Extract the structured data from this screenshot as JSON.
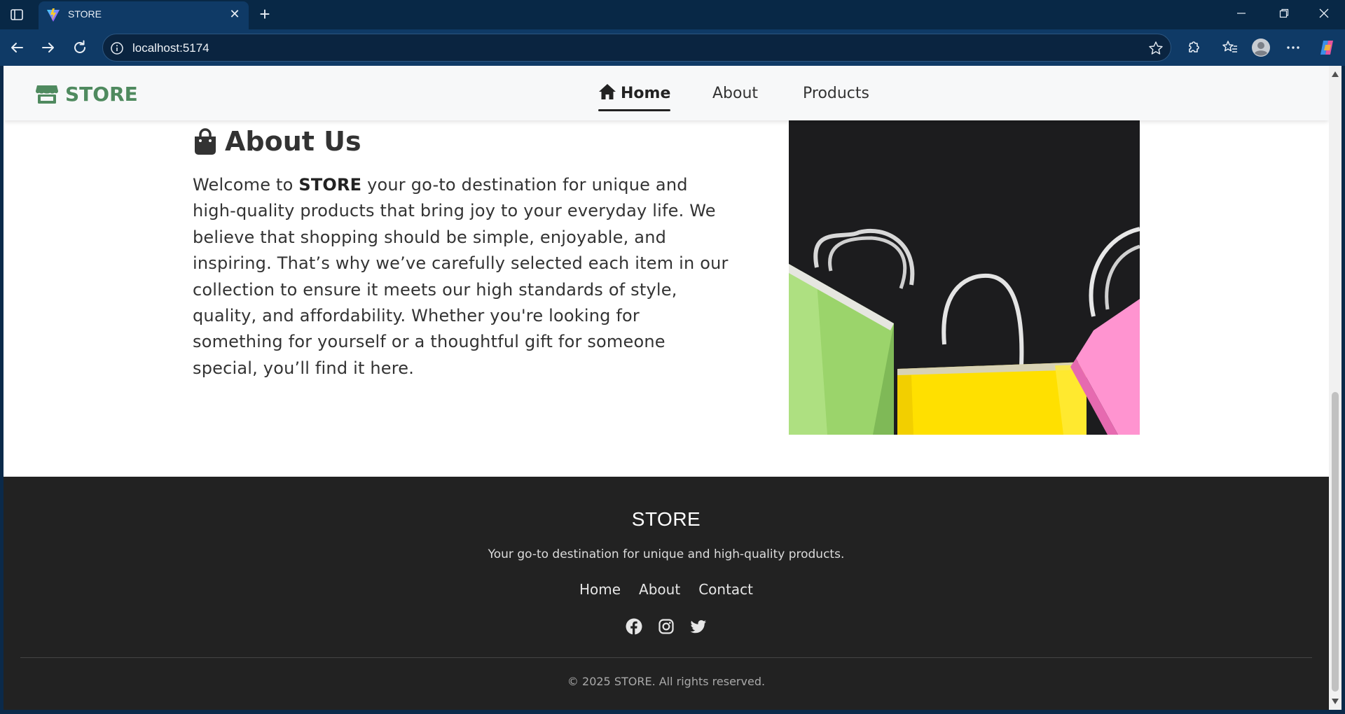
{
  "browser": {
    "tab_title": "STORE",
    "url": "localhost:5174",
    "icons": [
      "sidebar-icon",
      "vite-favicon",
      "close-icon",
      "new-tab-icon",
      "minimize-icon",
      "restore-icon",
      "window-close-icon",
      "back-icon",
      "forward-icon",
      "refresh-icon",
      "site-info-icon",
      "favorite-star-icon",
      "extensions-icon",
      "favorites-icon",
      "profile-icon",
      "more-icon",
      "copilot-icon"
    ]
  },
  "header": {
    "brand": "STORE",
    "brand_color": "#4f8a5f",
    "nav": [
      {
        "label": "Home",
        "active": true
      },
      {
        "label": "About",
        "active": false
      },
      {
        "label": "Products",
        "active": false
      }
    ]
  },
  "about": {
    "title": "About Us",
    "text_before": "Welcome to ",
    "text_bold": "STORE",
    "text_after": " your go-to destination for unique and high-quality products that bring joy to your everyday life. We believe that shopping should be simple, enjoyable, and inspiring. That’s why we’ve carefully selected each item in our collection to ensure it meets our high standards of style, quality, and affordability. Whether you're looking for something for yourself or a thoughtful gift for someone special, you’ll find it here.",
    "image_icon": "shopping-bags-image"
  },
  "footer": {
    "title": "STORE",
    "tagline": "Your go-to destination for unique and high-quality products.",
    "links": [
      "Home",
      "About",
      "Contact"
    ],
    "social": [
      "facebook-icon",
      "instagram-icon",
      "twitter-icon"
    ],
    "copyright": "© 2025 STORE. All rights reserved."
  }
}
